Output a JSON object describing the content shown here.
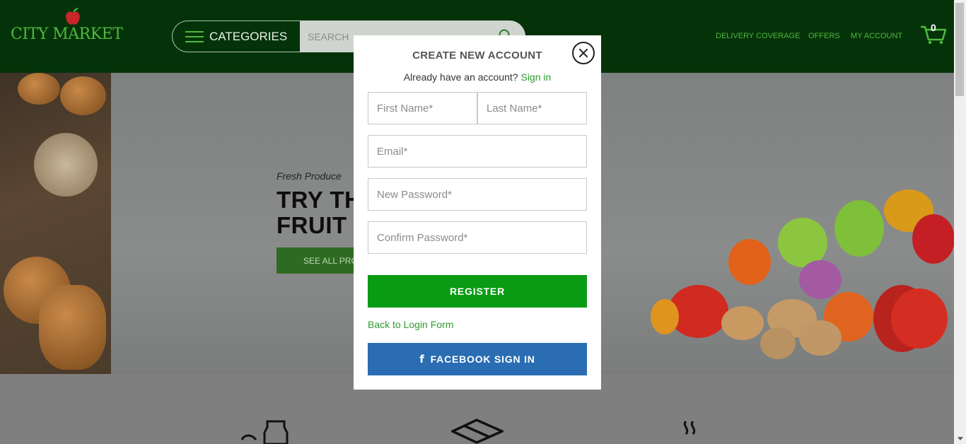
{
  "header": {
    "logo_text": "CITY MARKET",
    "categories_label": "CATEGORIES",
    "search_placeholder": "SEARCH",
    "nav": [
      "DELIVERY COVERAGE",
      "OFFERS",
      "MY ACCOUNT"
    ],
    "cart_count": "0"
  },
  "hero": {
    "tag": "Fresh Produce",
    "title": "TRY THE\nFRUIT A",
    "button_label": "SEE ALL PRO"
  },
  "modal": {
    "title": "CREATE NEW ACCOUNT",
    "already_text": "Already have an account?",
    "sign_in_link": "Sign in",
    "first_name_placeholder": "First Name*",
    "last_name_placeholder": "Last Name*",
    "email_placeholder": "Email*",
    "new_password_placeholder": "New Password*",
    "confirm_password_placeholder": "Confirm Password*",
    "register_label": "REGISTER",
    "back_link": "Back to Login Form",
    "facebook_label": "FACEBOOK SIGN IN"
  },
  "colors": {
    "header_bg": "#053309",
    "brand_green": "#4fb83e",
    "register_green": "#0a9b14",
    "facebook_blue": "#2a6db3",
    "link_green": "#2e9b2e"
  },
  "icons": [
    "apple-logo-icon",
    "hamburger-icon",
    "search-icon",
    "cart-icon",
    "close-icon",
    "facebook-icon",
    "milk-bottle-icon",
    "box-icon",
    "steam-icon"
  ]
}
